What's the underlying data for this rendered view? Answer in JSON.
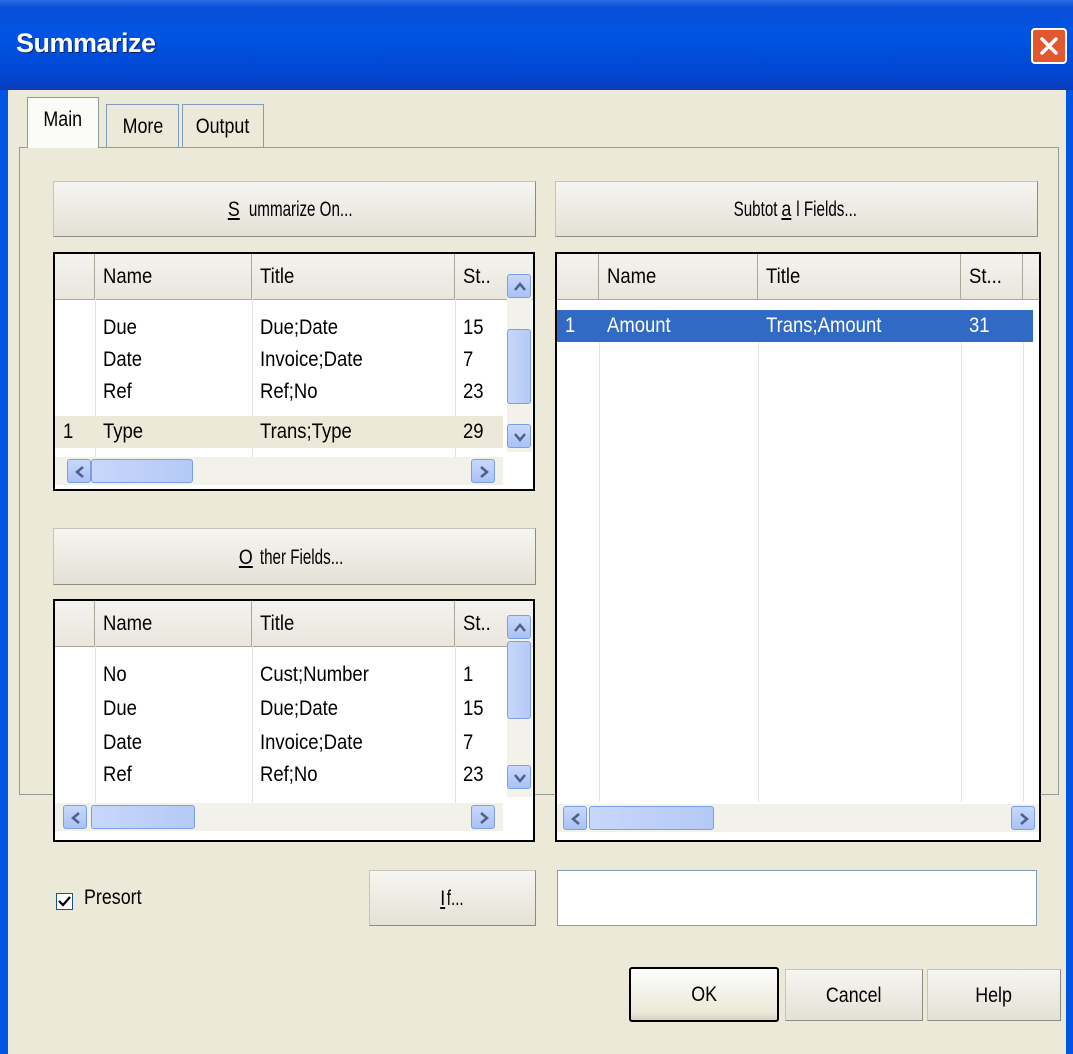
{
  "window": {
    "title": "Summarize"
  },
  "tabs": [
    {
      "label": "Main"
    },
    {
      "label": "More"
    },
    {
      "label": "Output"
    }
  ],
  "buttons": {
    "summarize_on": {
      "pre": "",
      "u": "S",
      "post": "ummarize On..."
    },
    "subtotal_fields": {
      "pre": "Subtot",
      "u": "a",
      "post": "l Fields..."
    },
    "other_fields": {
      "pre": "",
      "u": "O",
      "post": "ther Fields..."
    },
    "if": {
      "pre": "",
      "u": "I",
      "post": "f..."
    },
    "ok": "OK",
    "cancel": "Cancel",
    "help": "Help"
  },
  "summarize_grid": {
    "columns": [
      "Name",
      "Title",
      "St.."
    ],
    "rows": [
      {
        "num": "",
        "name": "Due",
        "title": "Due;Date",
        "st": "15"
      },
      {
        "num": "",
        "name": "Date",
        "title": "Invoice;Date",
        "st": "7"
      },
      {
        "num": "",
        "name": "Ref",
        "title": "Ref;No",
        "st": "23"
      },
      {
        "num": "1",
        "name": "Type",
        "title": "Trans;Type",
        "st": "29"
      }
    ]
  },
  "other_grid": {
    "columns": [
      "Name",
      "Title",
      "St.."
    ],
    "rows": [
      {
        "name": "No",
        "title": "Cust;Number",
        "st": "1"
      },
      {
        "name": "Due",
        "title": "Due;Date",
        "st": "15"
      },
      {
        "name": "Date",
        "title": "Invoice;Date",
        "st": "7"
      },
      {
        "name": "Ref",
        "title": "Ref;No",
        "st": "23"
      }
    ]
  },
  "subtotal_grid": {
    "columns": [
      "Name",
      "Title",
      "St..."
    ],
    "rows": [
      {
        "num": "1",
        "name": "Amount",
        "title": "Trans;Amount",
        "st": "31",
        "selected": true
      }
    ]
  },
  "presort": {
    "label": "Presort",
    "checked": true
  },
  "if_expression": {
    "value": ""
  },
  "colors": {
    "titlebar": "#0054e3",
    "selection": "#316ac5",
    "face": "#ece9d8"
  }
}
